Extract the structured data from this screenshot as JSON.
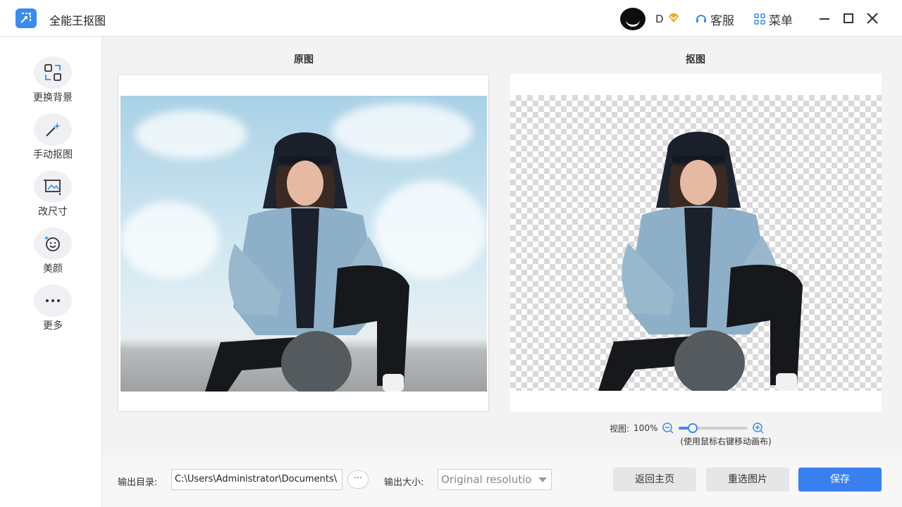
{
  "titlebar": {
    "app_title": "全能王抠图",
    "user_initial": "D",
    "service_label": "客服",
    "menu_label": "菜单",
    "accent_color": "#3a8bf0",
    "vip_color": "#f5a623"
  },
  "sidebar": {
    "items": [
      {
        "label": "更换背景",
        "icon": "replace-background-icon"
      },
      {
        "label": "手动抠图",
        "icon": "magic-wand-icon"
      },
      {
        "label": "改尺寸",
        "icon": "resize-image-icon"
      },
      {
        "label": "美颜",
        "icon": "beauty-face-icon"
      },
      {
        "label": "更多",
        "icon": "more-dots-icon"
      }
    ]
  },
  "main": {
    "original_title": "原图",
    "cutout_title": "抠图",
    "zoom": {
      "label": "视图:",
      "value": "100%",
      "level": 0.2,
      "hint": "(使用鼠标右键移动画布)"
    }
  },
  "footer": {
    "output_dir_label": "输出目录:",
    "output_dir_value": "C:\\Users\\Administrator\\Documents\\",
    "browse_label": "···",
    "output_size_label": "输出大小:",
    "output_size_value": "Original resolutio",
    "home_button": "返回主页",
    "reselect_button": "重选图片",
    "save_button": "保存",
    "save_color": "#3a7ff0"
  }
}
